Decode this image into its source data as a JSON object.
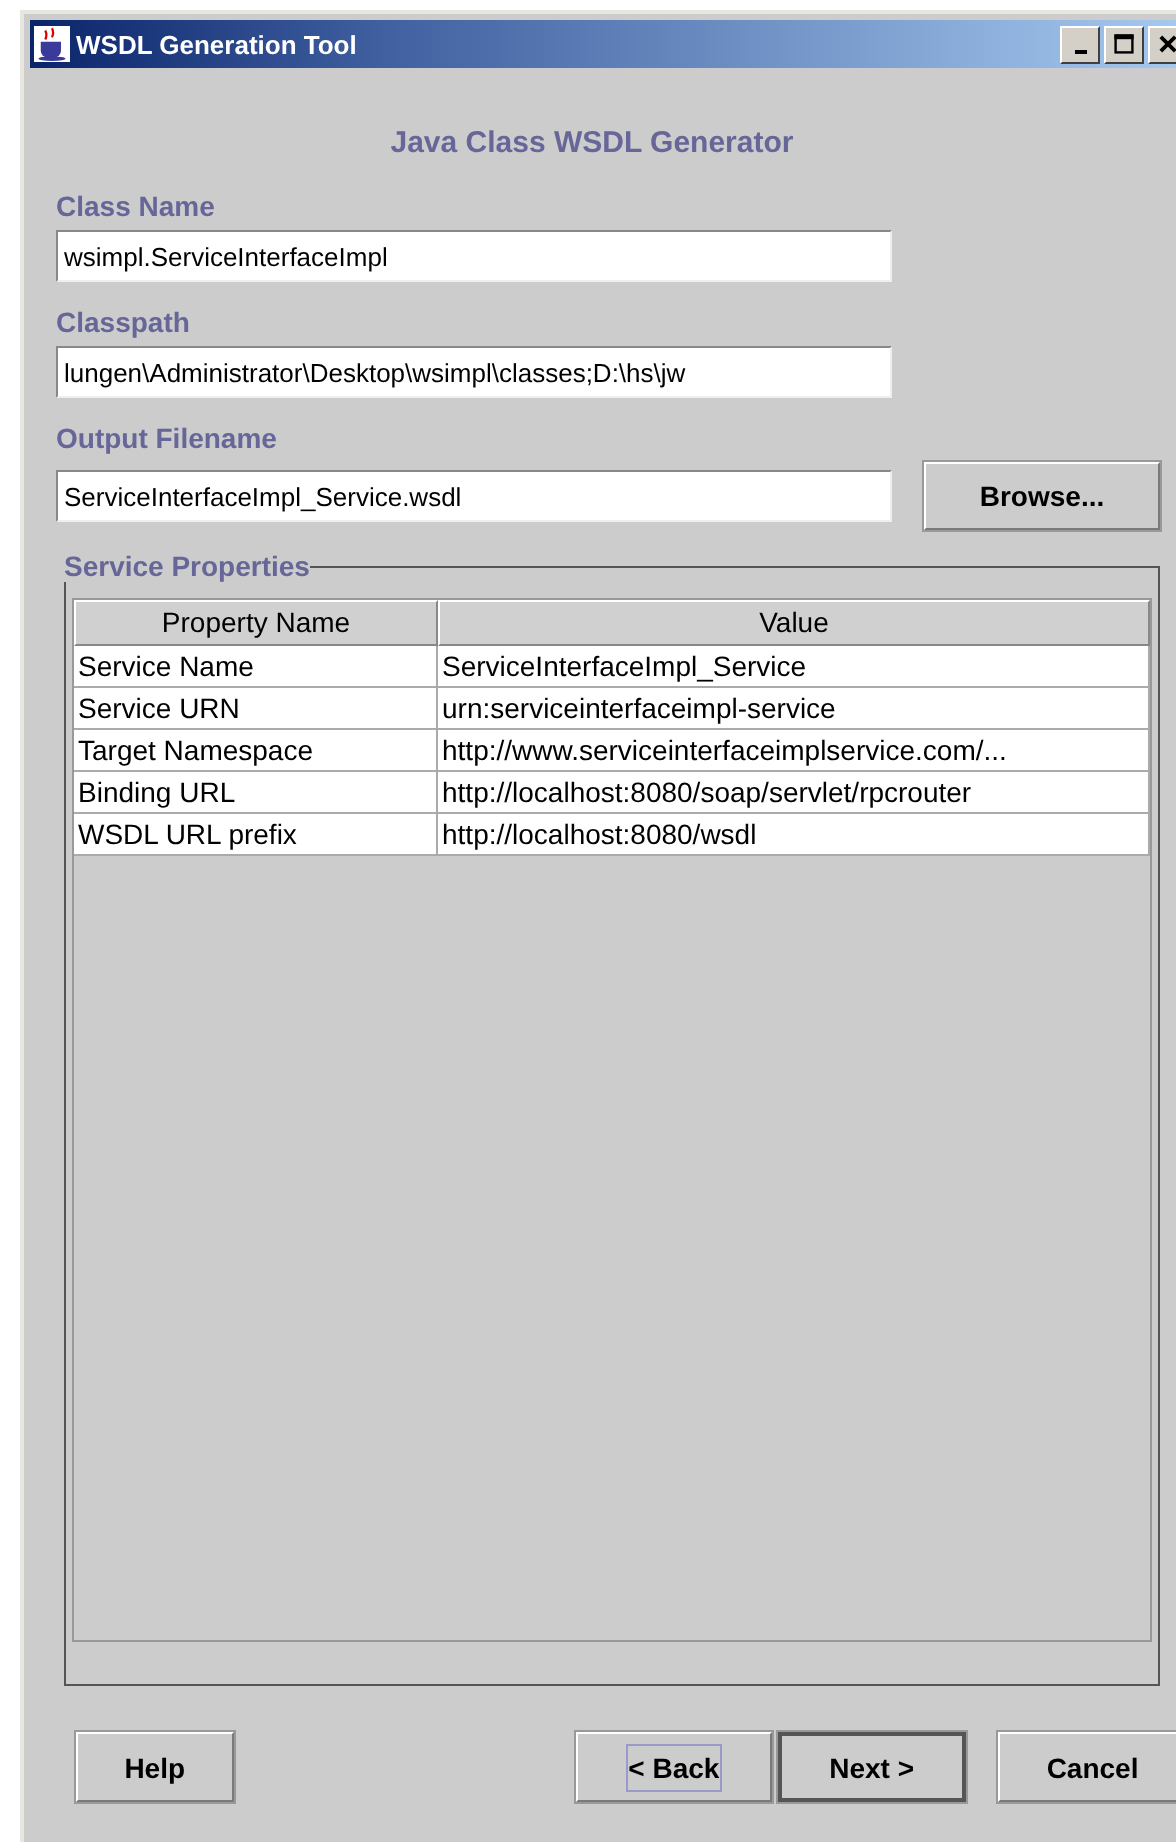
{
  "window": {
    "title": "WSDL Generation Tool"
  },
  "heading": "Java Class WSDL Generator",
  "fields": [
    {
      "label": "Class Name",
      "value": "wsimpl.ServiceInterfaceImpl"
    },
    {
      "label": "Classpath",
      "value": "lungen\\Administrator\\Desktop\\wsimpl\\classes;D:\\hs\\jw"
    },
    {
      "label": "Output Filename",
      "value": "ServiceInterfaceImpl_Service.wsdl",
      "button": "Browse..."
    }
  ],
  "service_properties": {
    "title": "Service Properties",
    "table": {
      "columns": [
        "Property Name",
        "Value"
      ],
      "rows": [
        [
          "Service Name",
          "ServiceInterfaceImpl_Service"
        ],
        [
          "Service URN",
          "urn:serviceinterfaceimpl-service"
        ],
        [
          "Target Namespace",
          "http://www.serviceinterfaceimplservice.com/..."
        ],
        [
          "Binding URL",
          "http://localhost:8080/soap/servlet/rpcrouter"
        ],
        [
          "WSDL URL prefix",
          "http://localhost:8080/wsdl"
        ]
      ]
    }
  },
  "buttons": [
    {
      "label": "Help",
      "focused": false,
      "default": false
    },
    {
      "label": "< Back",
      "focused": true,
      "default": false
    },
    {
      "label": "Next >",
      "focused": false,
      "default": true
    },
    {
      "label": "Cancel",
      "focused": false,
      "default": false
    }
  ]
}
